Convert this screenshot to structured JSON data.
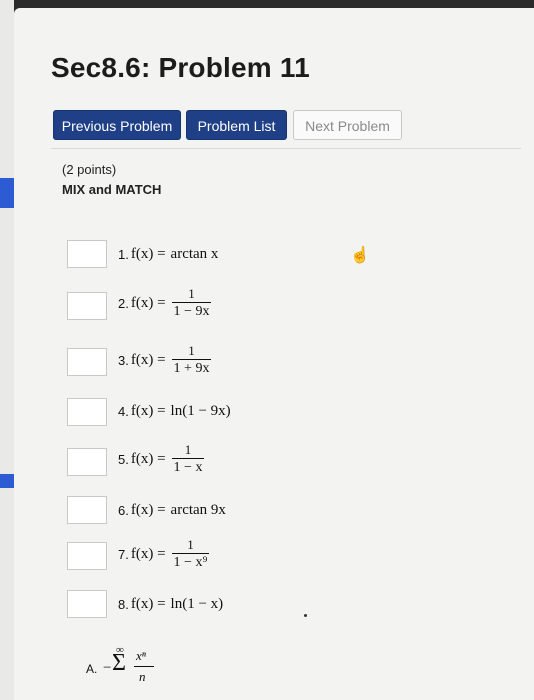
{
  "title": "Sec8.6: Problem 11",
  "nav": {
    "previous": "Previous Problem",
    "list": "Problem List",
    "next": "Next Problem"
  },
  "problem": {
    "points": "(2 points)",
    "instructions": "MIX and MATCH"
  },
  "items": [
    {
      "num": "1.",
      "lhs": "f(x) =",
      "expr": "arctan x"
    },
    {
      "num": "2.",
      "lhs": "f(x) =",
      "numerator": "1",
      "denominator": "1 − 9x"
    },
    {
      "num": "3.",
      "lhs": "f(x) =",
      "numerator": "1",
      "denominator": "1 + 9x"
    },
    {
      "num": "4.",
      "lhs": "f(x) =",
      "expr": "ln(1 − 9x)"
    },
    {
      "num": "5.",
      "lhs": "f(x) =",
      "numerator": "1",
      "denominator": "1 − x"
    },
    {
      "num": "6.",
      "lhs": "f(x) =",
      "expr": "arctan 9x"
    },
    {
      "num": "7.",
      "lhs": "f(x) =",
      "numerator": "1",
      "denominator": "1 − x⁹"
    },
    {
      "num": "8.",
      "lhs": "f(x) =",
      "expr": "ln(1 − x)"
    }
  ],
  "option_a": {
    "label": "A.",
    "sign": "−",
    "sigma": "Σ",
    "upper": "∞",
    "numerator": "xⁿ",
    "denominator": "n"
  },
  "colors": {
    "primary_button": "#1f3f86",
    "side_tab": "#2d5bd3"
  }
}
